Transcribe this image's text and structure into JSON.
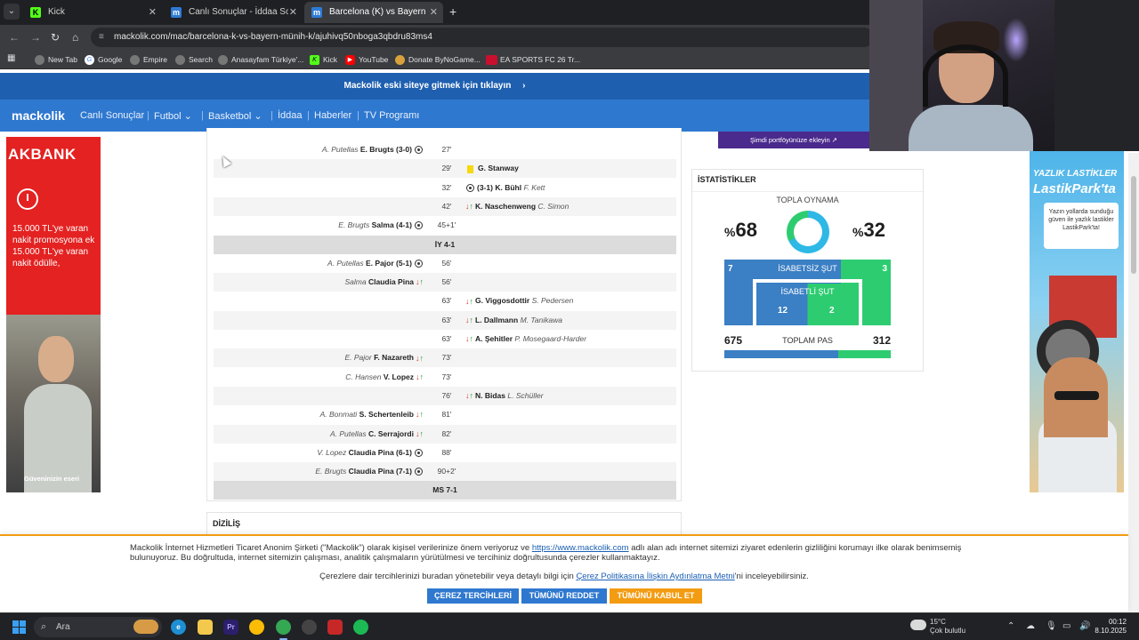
{
  "browser": {
    "tabs": [
      {
        "label": "Kick",
        "icon": "kick-icon",
        "active": false
      },
      {
        "label": "Canlı Sonuçlar - İddaa Sonuçları",
        "icon": "mackolik-icon",
        "active": false
      },
      {
        "label": "Barcelona (K) vs Bayern Münih",
        "icon": "mackolik-icon",
        "active": true
      }
    ],
    "url": "mackolik.com/mac/barcelona-k-vs-bayern-münih-k/ajuhivq50nboga3qbdru83ms4",
    "bookmarks": [
      "New Tab",
      "Google",
      "Empire",
      "Search",
      "Anasayfam Türkiye'...",
      "Kick",
      "YouTube",
      "Donate ByNoGame...",
      "EA SPORTS FC 26 Tr..."
    ]
  },
  "site": {
    "banner": "Mackolik eski siteye gitmek için tıklayın",
    "logo": "mackolik",
    "nav": [
      "Canlı Sonuçlar",
      "Futbol",
      "Basketbol",
      "İddaa",
      "Haberler",
      "TV Programı"
    ]
  },
  "ad_left": {
    "brand": "AKBANK",
    "promo": "15.000 TL'ye varan nakit promosyona ek 15.000 TL'ye varan nakit ödülle,",
    "tagline": "Güveninizin eseri"
  },
  "ad_right": {
    "line1": "YAZLIK LASTİKLER",
    "line2": "LastikPark'ta",
    "bubble": "Yazın yollarda sunduğu güven ile yazlık lastikler LastikPark'ta!"
  },
  "events": [
    {
      "min": "27'",
      "side": "home",
      "type": "goal",
      "assist": "A. Putellas",
      "player": "E. Brugts",
      "score": "(3-0)"
    },
    {
      "min": "29'",
      "side": "away",
      "type": "yellow",
      "player": "G. Stanway"
    },
    {
      "min": "32'",
      "side": "away",
      "type": "goal",
      "score": "(3-1)",
      "player": "K. Bühl",
      "assist": "F. Kett"
    },
    {
      "min": "42'",
      "side": "away",
      "type": "sub",
      "player": "K. Naschenweng",
      "assist": "C. Simon"
    },
    {
      "min": "45+1'",
      "side": "home",
      "type": "goal",
      "assist": "E. Brugts",
      "player": "Salma",
      "score": "(4-1)"
    },
    {
      "type": "half",
      "label": "İY 4-1"
    },
    {
      "min": "56'",
      "side": "home",
      "type": "goal",
      "assist": "A. Putellas",
      "player": "E. Pajor",
      "score": "(5-1)"
    },
    {
      "min": "56'",
      "side": "home",
      "type": "sub",
      "assist": "Salma",
      "player": "Claudia Pina"
    },
    {
      "min": "63'",
      "side": "away",
      "type": "sub",
      "player": "G. Viggosdottir",
      "assist": "S. Pedersen"
    },
    {
      "min": "63'",
      "side": "away",
      "type": "sub",
      "player": "L. Dallmann",
      "assist": "M. Tanikawa"
    },
    {
      "min": "63'",
      "side": "away",
      "type": "sub",
      "player": "A. Şehitler",
      "assist": "P. Mosegaard-Harder"
    },
    {
      "min": "73'",
      "side": "home",
      "type": "sub",
      "assist": "E. Pajor",
      "player": "F. Nazareth"
    },
    {
      "min": "73'",
      "side": "home",
      "type": "sub",
      "assist": "C. Hansen",
      "player": "V. Lopez"
    },
    {
      "min": "76'",
      "side": "away",
      "type": "sub",
      "player": "N. Bidas",
      "assist": "L. Schüller"
    },
    {
      "min": "81'",
      "side": "home",
      "type": "sub",
      "assist": "A. Bonmati",
      "player": "S. Schertenleib"
    },
    {
      "min": "82'",
      "side": "home",
      "type": "sub",
      "assist": "A. Putellas",
      "player": "C. Serrajordi"
    },
    {
      "min": "88'",
      "side": "home",
      "type": "goal",
      "assist": "V. Lopez",
      "player": "Claudia Pina",
      "score": "(6-1)"
    },
    {
      "min": "90+2'",
      "side": "home",
      "type": "goal",
      "assist": "E. Brugts",
      "player": "Claudia Pina",
      "score": "(7-1)"
    },
    {
      "type": "half",
      "label": "MS 7-1"
    }
  ],
  "lineup_title": "DİZİLİŞ",
  "portfolio": "Şimdi portföyünüze ekleyin",
  "stats": {
    "title": "İSTATİSTİKLER",
    "possession_label": "TOPLA OYNAMA",
    "possession_home": "68",
    "possession_away": "32",
    "percent_sign": "%",
    "shots_off_label": "İSABETSİZ ŞUT",
    "shots_off_home": "7",
    "shots_off_away": "3",
    "shots_on_label": "İSABETLİ ŞUT",
    "shots_on_home": "12",
    "shots_on_away": "2",
    "pass_label": "TOPLAM PAS",
    "pass_home": "675",
    "pass_away": "312",
    "colors": {
      "home": "#3b7fc4",
      "away": "#2ecc71"
    }
  },
  "cookie": {
    "text_before": "Mackolik İnternet Hizmetleri Ticaret Anonim Şirketi (\"Mackolik\") olarak kişisel verilerinize önem veriyoruz ve",
    "link1": "https://www.mackolik.com",
    "text_after": "adlı alan adı internet sitemizi ziyaret edenlerin gizliliğini korumayı ilke olarak benimsemiş bulunuyoruz. Bu doğrultuda, internet sitemizin çalışması, analitik çalışmaların yürütülmesi ve tercihiniz doğrultusunda çerezler kullanmaktayız.",
    "line2_before": "Çerezlere dair tercihlerinizi buradan yönetebilir veya detaylı bilgi için",
    "link2": "Çerez Politikasına İlişkin Aydınlatma Metni",
    "line2_after": "'ni inceleyebilirsiniz.",
    "btn_prefs": "ÇEREZ TERCİHLERİ",
    "btn_reject": "TÜMÜNÜ REDDET",
    "btn_accept": "TÜMÜNÜ KABUL ET"
  },
  "taskbar": {
    "search": "Ara",
    "weather_temp": "15°C",
    "weather_desc": "Çok bulutlu",
    "time": "00:12",
    "date": "8.10.2025"
  }
}
